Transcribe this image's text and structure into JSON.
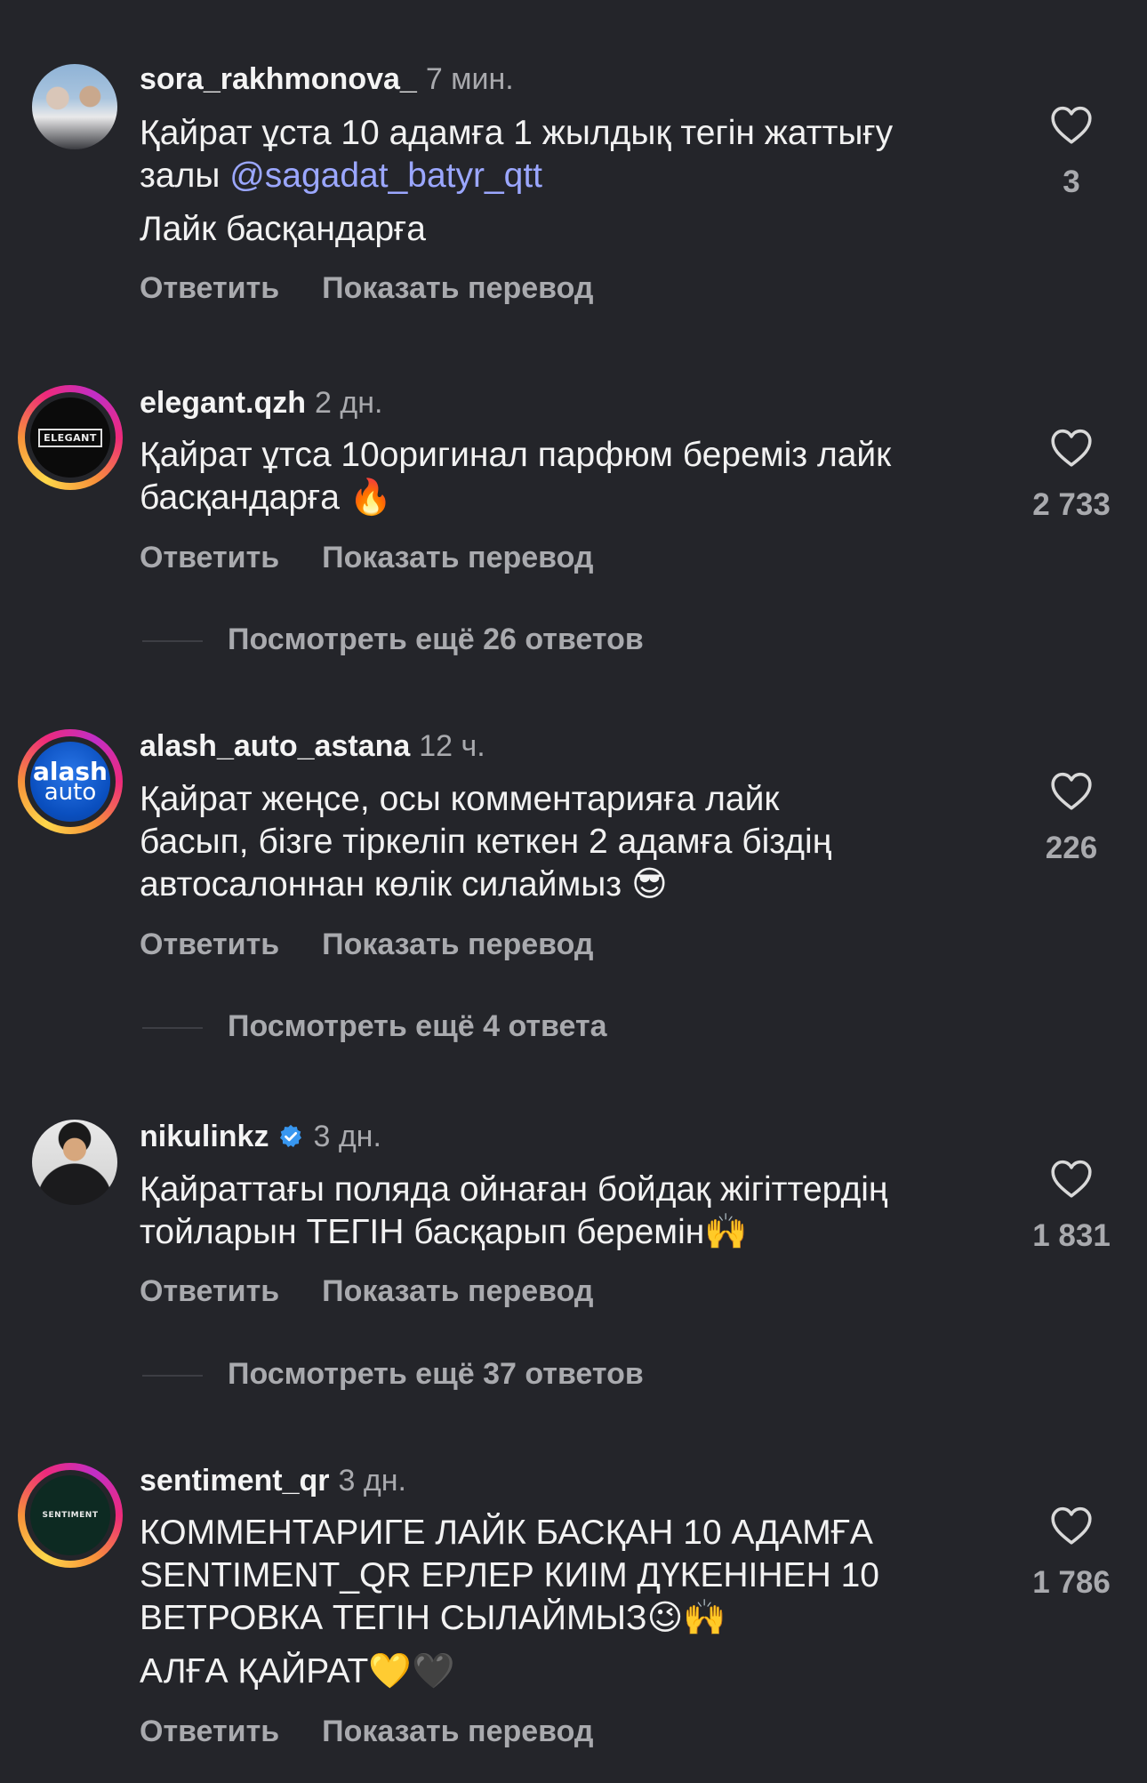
{
  "comments": [
    {
      "username": "sora_rakhmonova_",
      "time": "7 мин.",
      "verified": false,
      "line1": "Қайрат ұста 10 адамға 1 жылдық тегін жаттығу",
      "line2_text": "залы ",
      "mention": "@sagadat_batyr_qtt",
      "line3": "Лайк басқандарға",
      "likes": "3",
      "reply": "Ответить",
      "translate": "Показать перевод"
    },
    {
      "username": "elegant.qzh",
      "time": "2 дн.",
      "verified": false,
      "avatar_text": "ELEGANT",
      "line1": "Қайрат ұтса 10оригинал парфюм береміз лайк",
      "line2": "басқандарға ",
      "emoji": "🔥",
      "likes": "2 733",
      "reply": "Ответить",
      "translate": "Показать перевод",
      "more_replies": "Посмотреть ещё 26 ответов"
    },
    {
      "username": "alash_auto_astana",
      "time": "12 ч.",
      "verified": false,
      "avatar_text_1": "alash",
      "avatar_text_2": "auto",
      "line1": "Қайрат жеңсе, осы комментарияға лайк",
      "line2": "басып, бізге тіркеліп кеткен 2 адамға біздің",
      "line3": "автосалоннан көлік силаймыз ",
      "emoji": "😎",
      "likes": "226",
      "reply": "Ответить",
      "translate": "Показать перевод",
      "more_replies": "Посмотреть ещё 4 ответа"
    },
    {
      "username": "nikulinkz",
      "time": "3 дн.",
      "verified": true,
      "line1": "Қайраттағы поляда ойнаған бойдақ жігіттердің",
      "line2": "тойларын ТЕГІН басқарып беремін",
      "emoji": "🙌",
      "likes": "1 831",
      "reply": "Ответить",
      "translate": "Показать перевод",
      "more_replies": "Посмотреть ещё 37 ответов"
    },
    {
      "username": "sentiment_qr",
      "time": "3 дн.",
      "verified": false,
      "avatar_text": "SENTIMENT",
      "line1": "КОММЕНТАРИГЕ ЛАЙК БАСҚАН 10 АДАМҒА",
      "line2": "SENTIMENT_QR ЕРЛЕР КИІМ ДҮКЕНІНЕН 10",
      "line3": "ВЕТРОВКА ТЕГІН СЫЛАЙМЫЗ",
      "emoji_a": "😉🙌",
      "line4": "АЛҒА ҚАЙРАТ",
      "emoji_b": "💛🖤",
      "likes": "1 786",
      "reply": "Ответить",
      "translate": "Показать перевод"
    }
  ],
  "colors": {
    "background": "#24252a",
    "text": "#f2f2f2",
    "muted": "#a9aaae",
    "mention": "#9ba7ff",
    "verified": "#3897f0"
  }
}
